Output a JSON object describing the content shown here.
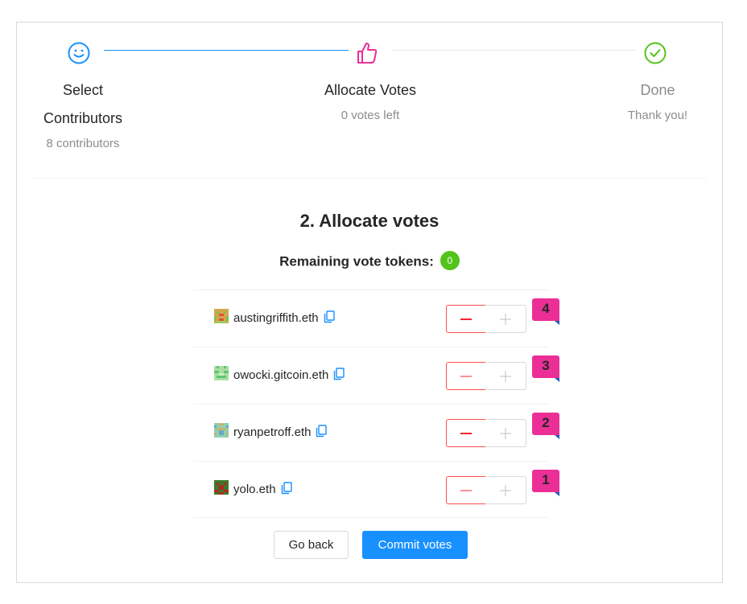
{
  "steps": [
    {
      "title_line1": "Select",
      "title_line2": "Contributors",
      "description": "8 contributors",
      "icon": "smile-icon",
      "status": "finished"
    },
    {
      "title": "Allocate Votes",
      "description": "0 votes left",
      "icon": "like-icon",
      "status": "current"
    },
    {
      "title": "Done",
      "description": "Thank you!",
      "icon": "check-circle-icon",
      "status": "waiting"
    }
  ],
  "heading": "2. Allocate votes",
  "remaining": {
    "label": "Remaining vote tokens:",
    "count": "0"
  },
  "contributors": [
    {
      "name": "austingriffith.eth",
      "votes": "4"
    },
    {
      "name": "owocki.gitcoin.eth",
      "votes": "3"
    },
    {
      "name": "ryanpetroff.eth",
      "votes": "2"
    },
    {
      "name": "yolo.eth",
      "votes": "1"
    }
  ],
  "actions": {
    "back_label": "Go back",
    "commit_label": "Commit votes"
  },
  "colors": {
    "primary": "#1890ff",
    "success": "#52c41a",
    "pink": "#eb2f96",
    "danger": "#ff4d4f",
    "ribbon_fold": "#1c5fb8"
  }
}
